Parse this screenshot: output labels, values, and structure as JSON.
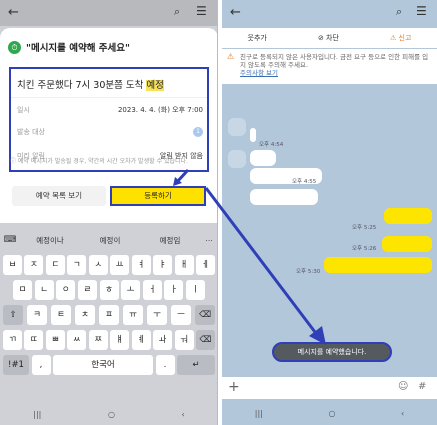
{
  "left": {
    "topbar": {
      "back": "←",
      "search": "⌕",
      "menu": "☰"
    },
    "sheet": {
      "title": "\"메시지를 예약해 주세요\"",
      "title_icon": "⏱",
      "message_prefix": "치킨 주문했다 7시 30분쯤 도착 ",
      "message_highlight": "예정",
      "rows": [
        {
          "label": "일시",
          "value": "2023. 4. 4. (화) 오후 7:00"
        },
        {
          "label": "발송 대상",
          "value": "1"
        },
        {
          "label": "미리 알림",
          "value": "알림 받지 않음"
        }
      ],
      "notice": "ⓘ 예약 메시지가 발송될 경우, 약간의 시간 오차가 발생할 수 있습니다.",
      "btn_list": "예약 목록 보기",
      "btn_register": "등록하기"
    },
    "keyboard": {
      "suggestions": [
        "예정이나",
        "예정이",
        "예정임"
      ],
      "row1": [
        "ㅂ",
        "ㅈ",
        "ㄷ",
        "ㄱ",
        "ㅅ",
        "ㅛ",
        "ㅕ",
        "ㅑ",
        "ㅐ",
        "ㅔ"
      ],
      "row2": [
        "ㅁ",
        "ㄴ",
        "ㅇ",
        "ㄹ",
        "ㅎ",
        "ㅗ",
        "ㅓ",
        "ㅏ",
        "ㅣ"
      ],
      "row3": [
        "⇧",
        "ㅋ",
        "ㅌ",
        "ㅊ",
        "ㅍ",
        "ㅠ",
        "ㅜ",
        "ㅡ",
        "⌫"
      ],
      "row4": [
        "ㄲ",
        "ㄸ",
        "ㅃ",
        "ㅆ",
        "ㅉ",
        "ㅒ",
        "ㅖ",
        "ㅘ",
        "ㅝ",
        "⌫"
      ],
      "sym": "!#1",
      "comma": ",",
      "space": "한국어",
      "period": ".",
      "enter": "↵"
    },
    "nav": [
      "|||",
      "○",
      "‹"
    ]
  },
  "right": {
    "topbar": {
      "back": "←",
      "search": "⌕",
      "menu": "☰"
    },
    "actions": {
      "add": "추가",
      "block": "차단",
      "report": "신고"
    },
    "warning": {
      "text": "친구로 등록되지 않은 사용자입니다. 금전 요구 등으로 인한 피해를 입지 않도록 주의해 주세요.",
      "link": "주의사항 보기"
    },
    "times": [
      "오후 4:54",
      "오후 4:55",
      "오후 5:25",
      "오후 5:26",
      "오후 5:30"
    ],
    "toast": "메시지를 예약했습니다.",
    "input": {
      "plus": "+",
      "emoji": "☺",
      "hash": "#"
    },
    "nav": [
      "|||",
      "○",
      "‹"
    ]
  },
  "colors": {
    "accent": "#2e3fb7",
    "kakao_yellow": "#fee500",
    "chat_bg": "#b2c7da"
  }
}
